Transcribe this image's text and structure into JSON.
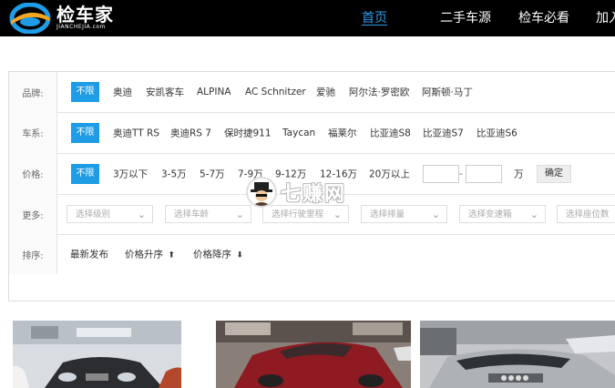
{
  "brand": {
    "name_cn": "检车家",
    "name_en": "JIANCHEJIA.com"
  },
  "nav": [
    {
      "label": "首页",
      "active": true
    },
    {
      "label": "二手车源",
      "active": false
    },
    {
      "label": "检车必看",
      "active": false
    },
    {
      "label": "加入",
      "active": false
    }
  ],
  "filters": {
    "brand": {
      "label": "品牌:",
      "all": "不限",
      "options": [
        "奥迪",
        "安凯客车",
        "ALPINA",
        "AC Schnitzer",
        "爱驰",
        "阿尔法·罗密欧",
        "阿斯顿·马丁"
      ]
    },
    "series": {
      "label": "车系:",
      "all": "不限",
      "options": [
        "奥迪TT RS",
        "奥迪RS 7",
        "保时捷911",
        "Taycan",
        "福莱尔",
        "比亚迪S8",
        "比亚迪S7",
        "比亚迪S6"
      ]
    },
    "price": {
      "label": "价格:",
      "all": "不限",
      "options": [
        "3万以下",
        "3-5万",
        "5-7万",
        "7-9万",
        "9-12万",
        "12-16万",
        "20万以上"
      ],
      "range_sep": "-",
      "unit": "万",
      "confirm": "确定"
    },
    "more": {
      "label": "更多:",
      "selects": [
        "选择级别",
        "选择车龄",
        "选择行驶里程",
        "选择排量",
        "选择变速箱",
        "选择座位数"
      ]
    },
    "sort": {
      "label": "排序:",
      "options": [
        {
          "text": "最新发布",
          "arrow": ""
        },
        {
          "text": "价格升序",
          "arrow": "⬆"
        },
        {
          "text": "价格降序",
          "arrow": "⬇"
        }
      ]
    }
  },
  "watermark": {
    "text": "七赚网"
  },
  "colors": {
    "accent": "#1e9ce6",
    "nav_active": "#2c9ce8",
    "topbar": "#000000"
  }
}
